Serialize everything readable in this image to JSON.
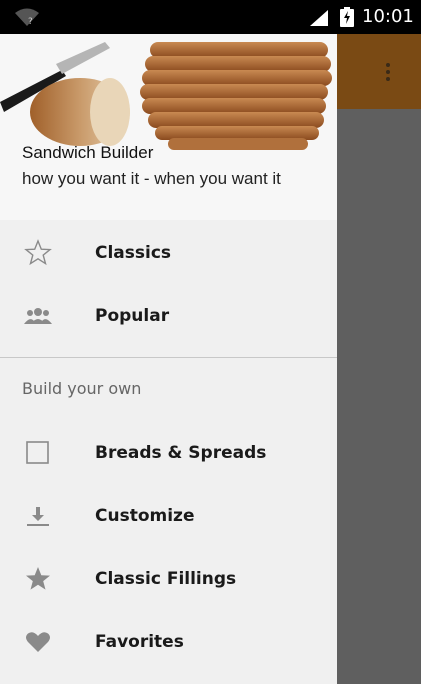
{
  "status_bar": {
    "time": "10:01",
    "icons": [
      "wifi-icon",
      "signal-icon",
      "battery-charging-icon"
    ]
  },
  "app_bar": {
    "color": "#7a4a14",
    "overflow_icon": "more-vert-icon"
  },
  "drawer": {
    "header": {
      "title": "Sandwich Builder",
      "subtitle": "how you want it - when you want it",
      "image": "bread-slices-image"
    },
    "primary_items": [
      {
        "label": "Classics",
        "icon": "star-outline-icon"
      },
      {
        "label": "Popular",
        "icon": "people-icon"
      }
    ],
    "section_title": "Build your own",
    "section_items": [
      {
        "label": "Breads & Spreads",
        "icon": "checkbox-outline-icon"
      },
      {
        "label": "Customize",
        "icon": "download-icon"
      },
      {
        "label": "Classic Fillings",
        "icon": "star-icon"
      },
      {
        "label": "Favorites",
        "icon": "heart-icon"
      }
    ]
  }
}
